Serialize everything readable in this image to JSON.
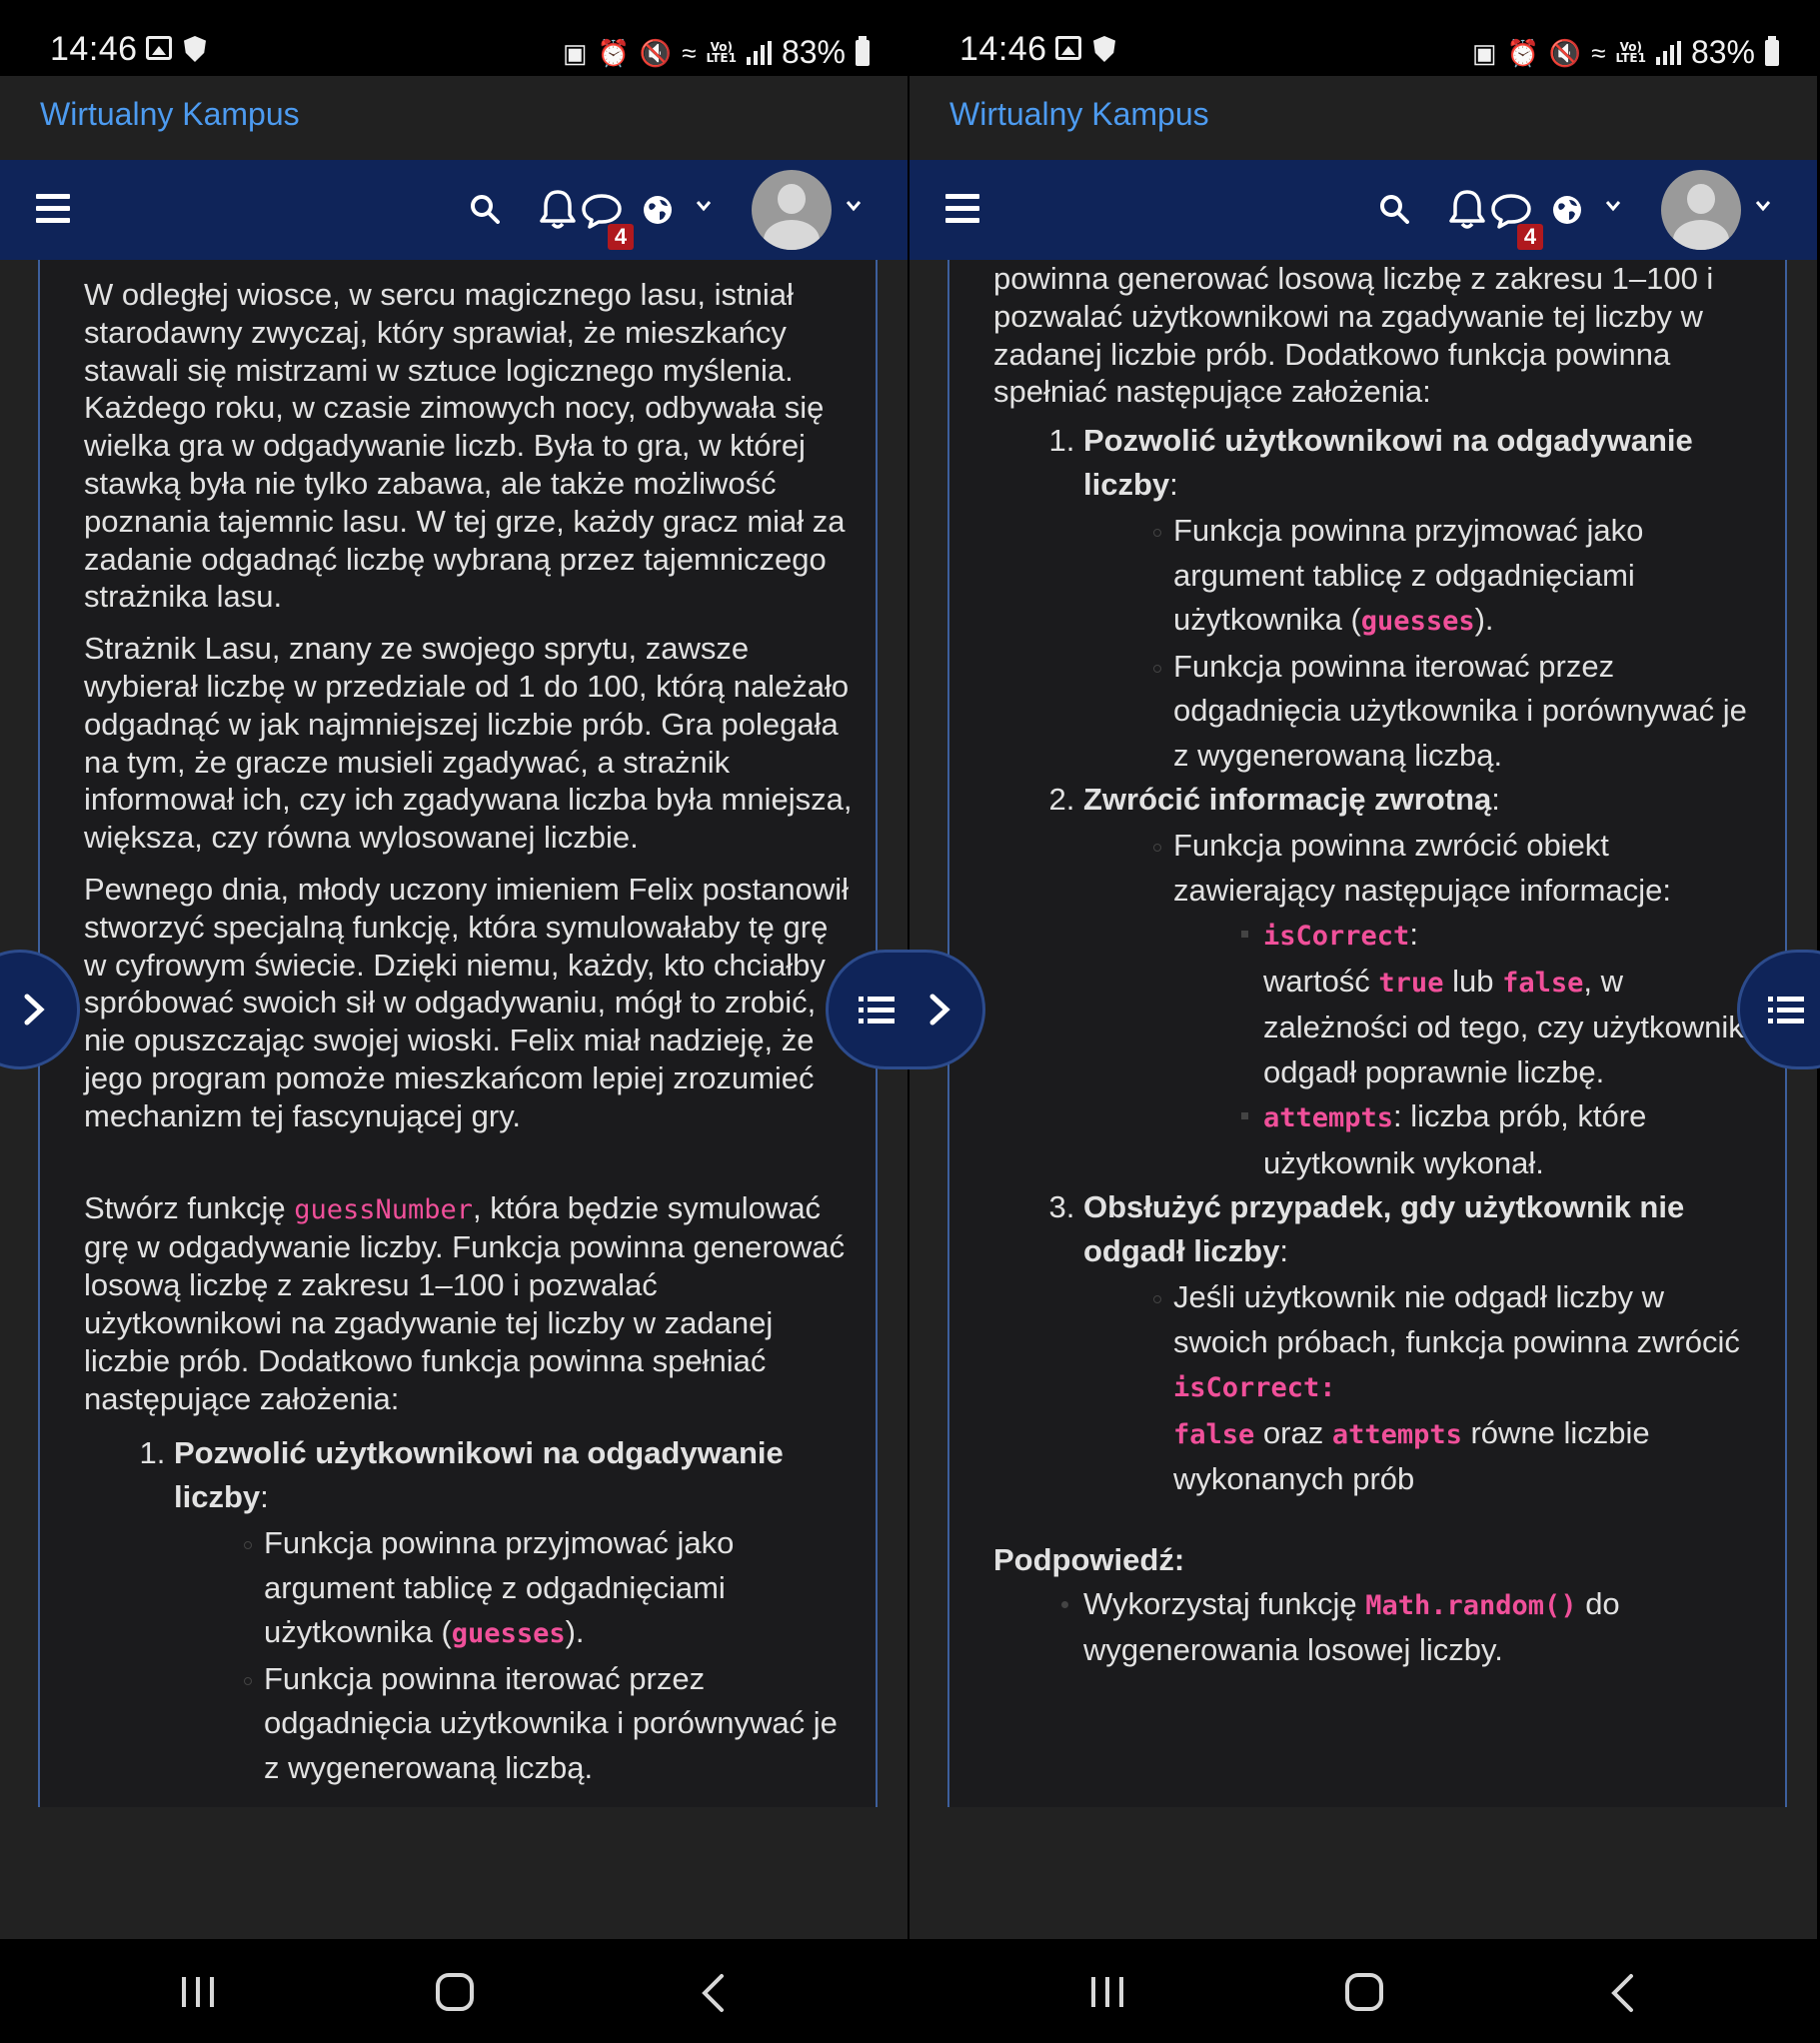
{
  "status_bar": {
    "time": "14:46",
    "battery": "83%"
  },
  "site": {
    "name": "Wirtualny Kampus"
  },
  "navbar": {
    "message_badge": "4"
  },
  "left_page": {
    "p1": "W odległej wiosce, w sercu magicznego lasu, istniał starodawny zwyczaj, który sprawiał, że mieszkańcy stawali się mistrzami w sztuce logicznego myślenia. Każdego roku, w czasie zimowych nocy, odbywała się wielka gra w odgadywanie liczb. Była to gra, w której stawką była nie tylko zabawa, ale także możliwość poznania tajemnic lasu. W tej grze, każdy gracz miał za zadanie odgadnąć liczbę wybraną przez tajemniczego strażnika lasu.",
    "p2": "Strażnik Lasu, znany ze swojego sprytu, zawsze wybierał liczbę w przedziale od 1 do 100, którą należało odgadnąć w jak najmniejszej liczbie prób. Gra polegała na tym, że gracze musieli zgadywać, a strażnik informował ich, czy ich zgadywana liczba była mniejsza, większa, czy równa wylosowanej liczbie.",
    "p3": "Pewnego dnia, młody uczony imieniem Felix postanowił stworzyć specjalną funkcję, która symulowałaby tę grę w cyfrowym świecie. Dzięki niemu, każdy, kto chciałby spróbować swoich sił w odgadywaniu, mógł to zrobić, nie opuszczając swojej wioski. Felix miał nadzieję, że jego program pomoże mieszkańcom lepiej zrozumieć mechanizm tej fascynującej gry.",
    "p4_before": "Stwórz funkcję ",
    "p4_code": "guessNumber",
    "p4_after": ", która będzie symulować grę w odgadywanie liczby. Funkcja powinna generować losową liczbę z zakresu 1–100 i pozwalać użytkownikowi na zgadywanie tej liczby w zadanej liczbie prób. Dodatkowo funkcja powinna spełniać następujące założenia:",
    "item1_title": "Pozwolić użytkownikowi na odgadywanie liczby",
    "item1_colon": ":",
    "item1_sub1_before": "Funkcja powinna przyjmować jako argument tablicę z odgadnięciami użytkownika (",
    "item1_sub1_code": "guesses",
    "item1_sub1_after": ").",
    "item1_sub2": "Funkcja powinna iterować przez odgadnięcia użytkownika i porównywać je z wygenerowaną liczbą."
  },
  "right_page": {
    "intro": "powinna generować losową liczbę z zakresu 1–100 i pozwalać użytkownikowi na zgadywanie tej liczby w zadanej liczbie prób. Dodatkowo funkcja powinna spełniać następujące założenia:",
    "item1_title": "Pozwolić użytkownikowi na odgadywanie liczby",
    "item1_colon": ":",
    "item1_sub1_before": "Funkcja powinna przyjmować jako argument tablicę z odgadnięciami użytkownika (",
    "item1_sub1_code": "guesses",
    "item1_sub1_after": ").",
    "item1_sub2": "Funkcja powinna iterować przez odgadnięcia użytkownika i porównywać je z wygenerowaną liczbą.",
    "item2_title": "Zwrócić informację zwrotną",
    "item2_colon": ":",
    "item2_sub1": "Funkcja powinna zwrócić obiekt zawierający następujące informacje:",
    "item2_a_code": "isCorrect",
    "item2_a_colon": ":",
    "item2_a_text1": "wartość ",
    "item2_a_true": "true",
    "item2_a_text2": " lub ",
    "item2_a_false": "false",
    "item2_a_text3": ", w zależności od tego, czy użytkownik odgadł poprawnie liczbę.",
    "item2_b_code": "attempts",
    "item2_b_text": ": liczba prób, które użytkownik wykonał.",
    "item3_title": "Obsłużyć przypadek, gdy użytkownik nie odgadł liczby",
    "item3_colon": ":",
    "item3_sub1_before": "Jeśli użytkownik nie odgadł liczby w swoich próbach, funkcja powinna zwrócić ",
    "item3_sub1_code1": "isCorrect:",
    "item3_sub1_code2": "false",
    "item3_sub1_mid": " oraz ",
    "item3_sub1_code3": "attempts",
    "item3_sub1_after": " równe liczbie wykonanych prób",
    "hint_title": "Podpowiedź:",
    "hint_before": "Wykorzystaj funkcję ",
    "hint_code": "Math.random()",
    "hint_after": " do wygenerowania losowej liczby."
  },
  "colors": {
    "accent": "#0f2459",
    "link": "#4d9bf0",
    "code": "#f0509a",
    "badge": "#b0191e",
    "card_bg": "#1b1b1d",
    "text": "#e2e2e2"
  },
  "icons": [
    "menu-icon",
    "search-icon",
    "bell-icon",
    "chat-icon",
    "globe-icon",
    "chevron-down-icon",
    "avatar",
    "chevron-right-icon",
    "list-icon",
    "recents-icon",
    "home-icon",
    "back-icon"
  ]
}
